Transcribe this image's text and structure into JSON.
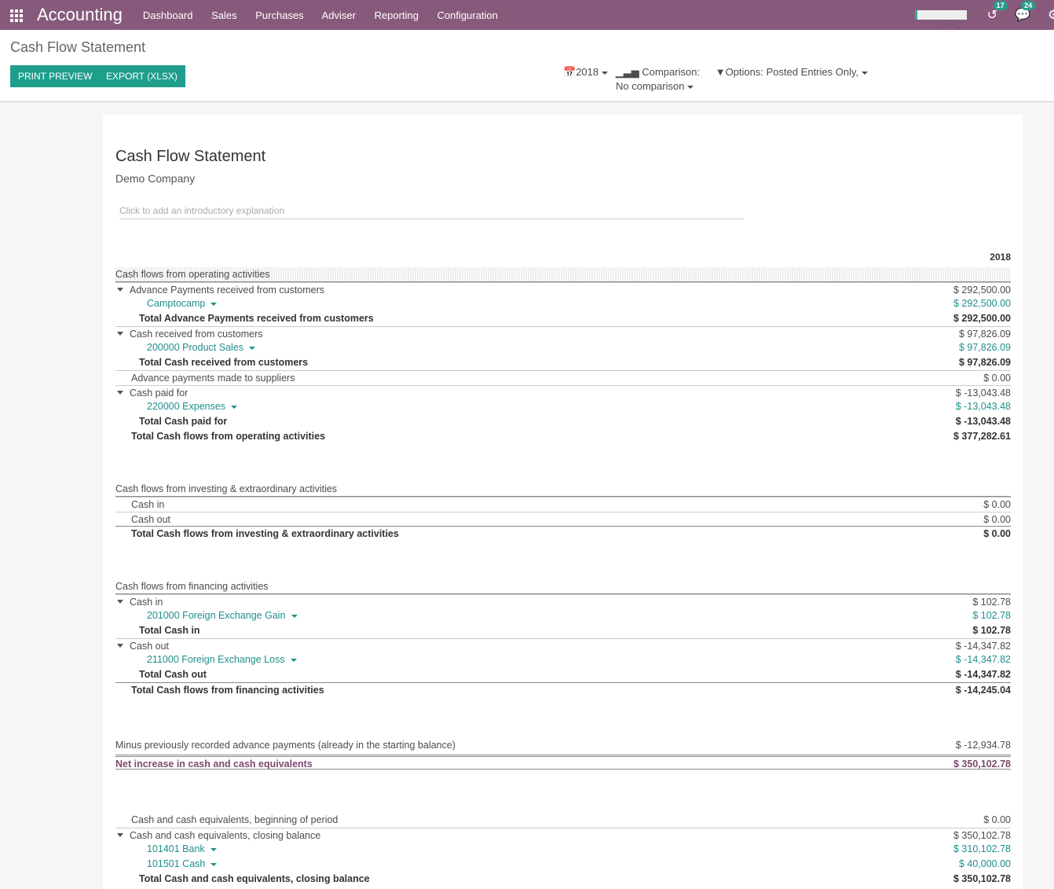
{
  "nav": {
    "brand": "Accounting",
    "menu": [
      "Dashboard",
      "Sales",
      "Purchases",
      "Adviser",
      "Reporting",
      "Configuration"
    ],
    "activity_count": "17",
    "message_count": "24"
  },
  "control": {
    "title": "Cash Flow Statement",
    "print_label": "PRINT PREVIEW",
    "export_label": "EXPORT (XLSX)",
    "date_filter": "2018",
    "comparison_label": "Comparison:",
    "comparison_value": "No comparison",
    "options_label": "Options: Posted Entries Only,"
  },
  "report": {
    "title": "Cash Flow Statement",
    "company": "Demo Company",
    "intro_placeholder": "Click to add an introductory explanation",
    "column": "2018",
    "sections": [
      {
        "rows": [
          {
            "type": "sec",
            "label": "Cash flows from operating activities",
            "value": ""
          },
          {
            "type": "l1c",
            "label": "Advance Payments received from customers",
            "value": "$ 292,500.00"
          },
          {
            "type": "acc",
            "label": "Camptocamp",
            "value": "$ 292,500.00"
          },
          {
            "type": "tot",
            "label": "Total Advance Payments received from customers",
            "value": "$ 292,500.00"
          },
          {
            "type": "l1c",
            "label": "Cash received from customers",
            "value": "$ 97,826.09"
          },
          {
            "type": "acc",
            "label": "200000 Product Sales",
            "value": "$ 97,826.09"
          },
          {
            "type": "tot",
            "label": "Total Cash received from customers",
            "value": "$ 97,826.09"
          },
          {
            "type": "l1",
            "label": "Advance payments made to suppliers",
            "value": "$ 0.00"
          },
          {
            "type": "l1c",
            "label": "Cash paid for",
            "value": "$ -13,043.48"
          },
          {
            "type": "acc",
            "label": "220000 Expenses",
            "value": "$ -13,043.48"
          },
          {
            "type": "tot",
            "label": "Total Cash paid for",
            "value": "$ -13,043.48"
          },
          {
            "type": "gtotn",
            "label": "Total Cash flows from operating activities",
            "value": "$ 377,282.61"
          }
        ]
      },
      {
        "rows": [
          {
            "type": "secp",
            "label": "Cash flows from investing & extraordinary activities",
            "value": ""
          },
          {
            "type": "l1",
            "label": "Cash in",
            "value": "$ 0.00"
          },
          {
            "type": "l1",
            "label": "Cash out",
            "value": "$ 0.00"
          },
          {
            "type": "gtot",
            "label": "Total Cash flows from investing & extraordinary activities",
            "value": "$ 0.00"
          }
        ]
      },
      {
        "rows": [
          {
            "type": "secp",
            "label": "Cash flows from financing activities",
            "value": ""
          },
          {
            "type": "l1c",
            "label": "Cash in",
            "value": "$ 102.78"
          },
          {
            "type": "acc",
            "label": "201000 Foreign Exchange Gain",
            "value": "$ 102.78"
          },
          {
            "type": "tot",
            "label": "Total Cash in",
            "value": "$ 102.78"
          },
          {
            "type": "l1c",
            "label": "Cash out",
            "value": "$ -14,347.82"
          },
          {
            "type": "acc",
            "label": "211000 Foreign Exchange Loss",
            "value": "$ -14,347.82"
          },
          {
            "type": "tot",
            "label": "Total Cash out",
            "value": "$ -14,347.82"
          },
          {
            "type": "gtot",
            "label": "Total Cash flows from financing activities",
            "value": "$ -14,245.04"
          }
        ]
      },
      {
        "rows": [
          {
            "type": "plain",
            "label": "Minus previously recorded advance payments (already in the starting balance)",
            "value": "$ -12,934.78"
          },
          {
            "type": "net",
            "label": "Net increase in cash and cash equivalents",
            "value": "$ 350,102.78"
          }
        ]
      },
      {
        "rows": [
          {
            "type": "l1n",
            "label": "Cash and cash equivalents, beginning of period",
            "value": "$ 0.00"
          },
          {
            "type": "l1c",
            "label": "Cash and cash equivalents, closing balance",
            "value": "$ 350,102.78"
          },
          {
            "type": "acc",
            "label": "101401 Bank",
            "value": "$ 310,102.78"
          },
          {
            "type": "acc",
            "label": "101501 Cash",
            "value": "$ 40,000.00"
          },
          {
            "type": "tot",
            "label": "Total Cash and cash equivalents, closing balance",
            "value": "$ 350,102.78"
          }
        ]
      }
    ]
  }
}
